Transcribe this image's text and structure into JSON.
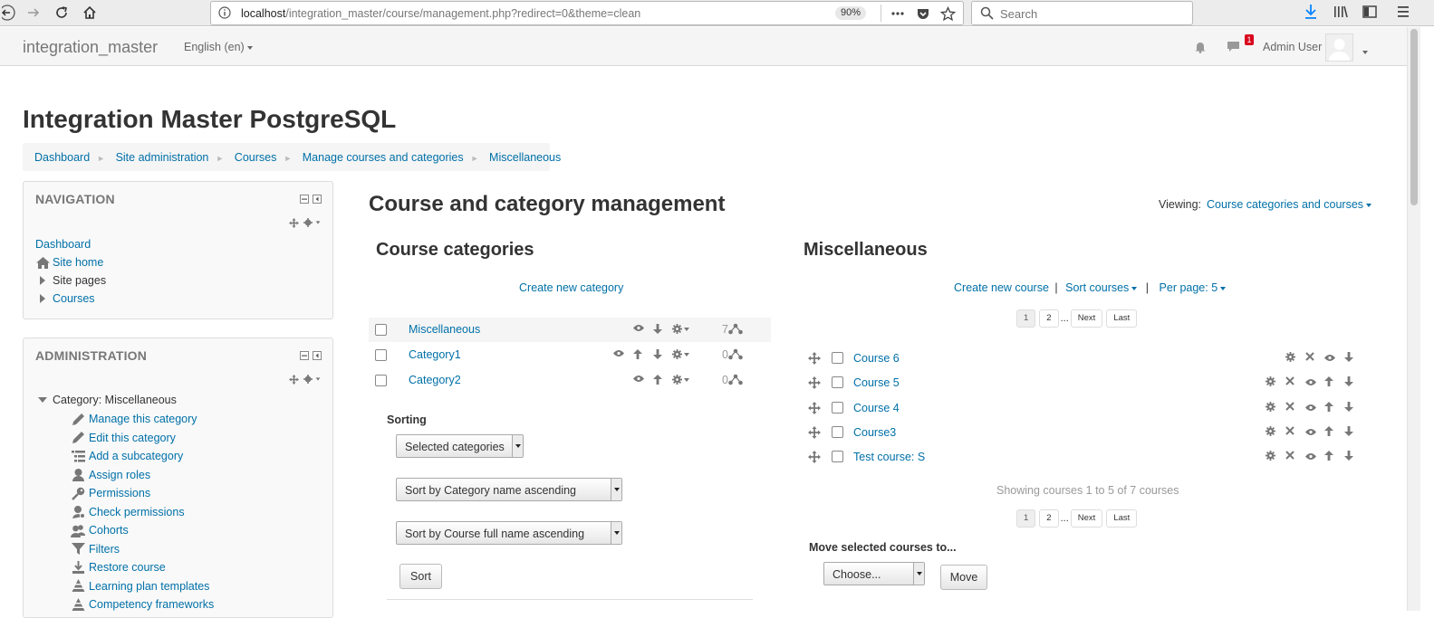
{
  "browser": {
    "url_host": "localhost",
    "url_rest": "/integration_master/course/management.php?redirect=0&theme=clean",
    "zoom": "90%",
    "search_placeholder": "Search"
  },
  "navbar": {
    "brand": "integration_master",
    "language": "English (en)",
    "notification_count": "1",
    "user_name": "Admin User"
  },
  "page": {
    "heading": "Integration Master PostgreSQL",
    "breadcrumb": [
      "Dashboard",
      "Site administration",
      "Courses",
      "Manage courses and categories",
      "Miscellaneous"
    ]
  },
  "navigation_block": {
    "title": "NAVIGATION",
    "items": [
      "Dashboard",
      "Site home",
      "Site pages",
      "Courses"
    ]
  },
  "administration_block": {
    "title": "ADMINISTRATION",
    "category": "Category: Miscellaneous",
    "items": [
      {
        "label": "Manage this category",
        "icon": "pencil-icon"
      },
      {
        "label": "Edit this category",
        "icon": "pencil-icon"
      },
      {
        "label": "Add a subcategory",
        "icon": "subcategory-icon"
      },
      {
        "label": "Assign roles",
        "icon": "user-icon"
      },
      {
        "label": "Permissions",
        "icon": "key-icon"
      },
      {
        "label": "Check permissions",
        "icon": "user-check-icon"
      },
      {
        "label": "Cohorts",
        "icon": "users-icon"
      },
      {
        "label": "Filters",
        "icon": "filter-icon"
      },
      {
        "label": "Restore course",
        "icon": "restore-icon"
      },
      {
        "label": "Learning plan templates",
        "icon": "pyramid-icon"
      },
      {
        "label": "Competency frameworks",
        "icon": "pyramid-icon"
      }
    ]
  },
  "management": {
    "title": "Course and category management",
    "viewing_label": "Viewing:",
    "viewing_value": "Course categories and courses",
    "categories": {
      "title": "Course categories",
      "create_link": "Create new category",
      "rows": [
        {
          "name": "Miscellaneous",
          "count": "7"
        },
        {
          "name": "Category1",
          "count": "0"
        },
        {
          "name": "Category2",
          "count": "0"
        }
      ],
      "sorting_label": "Sorting",
      "scope_select": "Selected categories",
      "category_sort_select": "Sort by Category name ascending",
      "course_sort_select": "Sort by Course full name ascending",
      "sort_button": "Sort"
    },
    "courses": {
      "title": "Miscellaneous",
      "create_link": "Create new course",
      "sort_link": "Sort courses",
      "per_page_link": "Per page: 5",
      "pager": {
        "page1": "1",
        "page2": "2",
        "dots": "...",
        "next": "Next",
        "last": "Last"
      },
      "rows": [
        "Course 6",
        "Course 5",
        "Course 4",
        "Course3",
        "Test course: S"
      ],
      "showing": "Showing courses 1 to 5 of 7 courses",
      "move_label": "Move selected courses to...",
      "move_select": "Choose...",
      "move_button": "Move"
    }
  }
}
